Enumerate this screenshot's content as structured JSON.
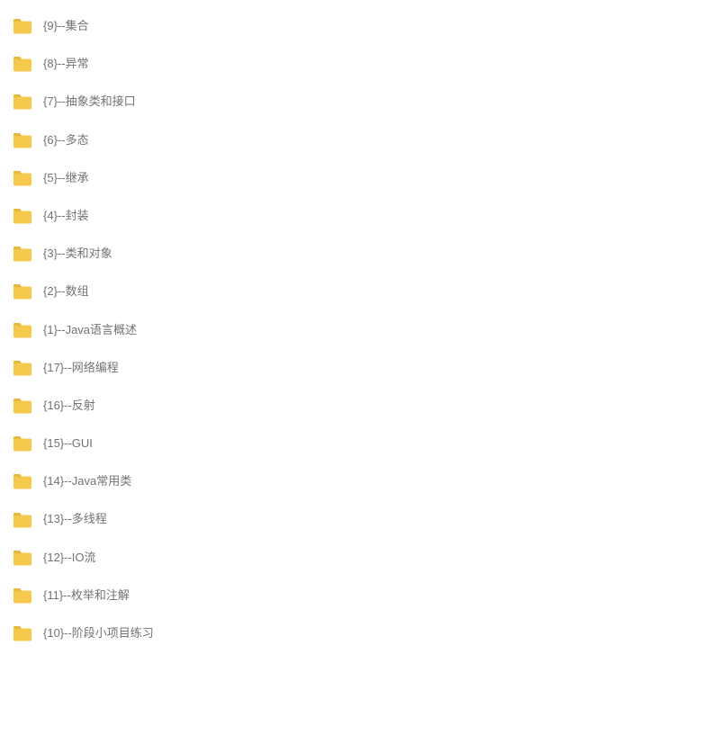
{
  "folders": [
    {
      "name": "{9}--集合"
    },
    {
      "name": "{8}--异常"
    },
    {
      "name": "{7}--抽象类和接口"
    },
    {
      "name": "{6}--多态"
    },
    {
      "name": "{5}--继承"
    },
    {
      "name": "{4}--封装"
    },
    {
      "name": "{3}--类和对象"
    },
    {
      "name": "{2}--数组"
    },
    {
      "name": "{1}--Java语言概述"
    },
    {
      "name": "{17}--网络编程"
    },
    {
      "name": "{16}--反射"
    },
    {
      "name": "{15}--GUI"
    },
    {
      "name": "{14}--Java常用类"
    },
    {
      "name": "{13}--多线程"
    },
    {
      "name": "{12}--IO流"
    },
    {
      "name": "{11}--枚举和注解"
    },
    {
      "name": "{10}--阶段小项目练习"
    }
  ],
  "colors": {
    "folder_fill": "#F4C94C",
    "folder_tab": "#E8B93A",
    "text": "#737373"
  }
}
